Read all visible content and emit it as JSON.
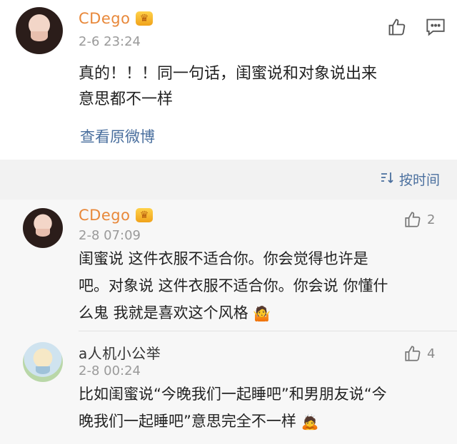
{
  "post": {
    "author": "CDego",
    "timestamp": "2-6 23:24",
    "text_line1": "真的！！！同一句话，闺蜜说和对象说出来",
    "text_line2": "意思都不一样",
    "view_original": "查看原微博",
    "like_icon": "thumbs-up-icon",
    "comment_icon": "comment-icon"
  },
  "sort": {
    "label": "按时间",
    "icon": "sort-icon"
  },
  "comments": [
    {
      "author": "CDego",
      "timestamp": "2-8 07:09",
      "likes": "2",
      "line1": "闺蜜说 这件衣服不适合你。你会觉得也许是",
      "line2": "吧。对象说 这件衣服不适合你。你会说 你懂什",
      "line3": "么鬼 我就是喜欢这个风格",
      "emoji": "🤷"
    },
    {
      "author": "a人机小公举",
      "timestamp": "2-8 00:24",
      "likes": "4",
      "line1": "比如闺蜜说“今晚我们一起睡吧”和男朋友说“今",
      "line2": "晚我们一起睡吧”意思完全不一样",
      "emoji": "🙇"
    }
  ],
  "colors": {
    "username": "#e8883a",
    "link": "#4a6f9e",
    "muted": "#9a9a9a"
  }
}
